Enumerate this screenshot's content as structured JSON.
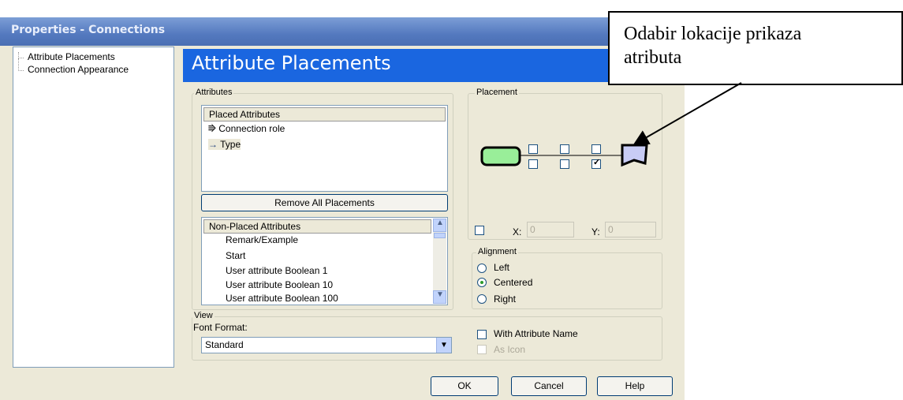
{
  "window": {
    "title": "Properties - Connections"
  },
  "tree": {
    "items": [
      "Attribute Placements",
      "Connection Appearance"
    ]
  },
  "header": {
    "title": "Attribute Placements"
  },
  "attributes": {
    "group_label": "Attributes",
    "placed_header": "Placed Attributes",
    "placed": [
      {
        "label": "Connection role",
        "icon": "connection-role-icon"
      },
      {
        "label": "Type",
        "icon": "type-arrow-icon"
      }
    ],
    "remove_button": "Remove All Placements",
    "nonplaced_header": "Non-Placed Attributes",
    "nonplaced": [
      "Remark/Example",
      "Start",
      "User attribute Boolean 1",
      "User attribute Boolean 10",
      "User attribute Boolean 100"
    ]
  },
  "placement": {
    "group_label": "Placement",
    "x_label": "X:",
    "x_value": "0",
    "y_label": "Y:",
    "y_value": "0"
  },
  "alignment": {
    "group_label": "Alignment",
    "options": [
      "Left",
      "Centered",
      "Right"
    ],
    "selected": "Centered"
  },
  "view": {
    "group_label": "View",
    "font_format_label": "Font Format:",
    "font_format_value": "Standard",
    "with_attribute_name": "With Attribute Name",
    "as_icon": "As Icon"
  },
  "buttons": {
    "ok": "OK",
    "cancel": "Cancel",
    "help": "Help"
  },
  "callout": {
    "line1": "Odabir lokacije prikaza",
    "line2": "atributa"
  },
  "colors": {
    "header_blue": "#1a66e0",
    "node_green": "#99ee99",
    "node_lilac": "#c8ccf5"
  }
}
